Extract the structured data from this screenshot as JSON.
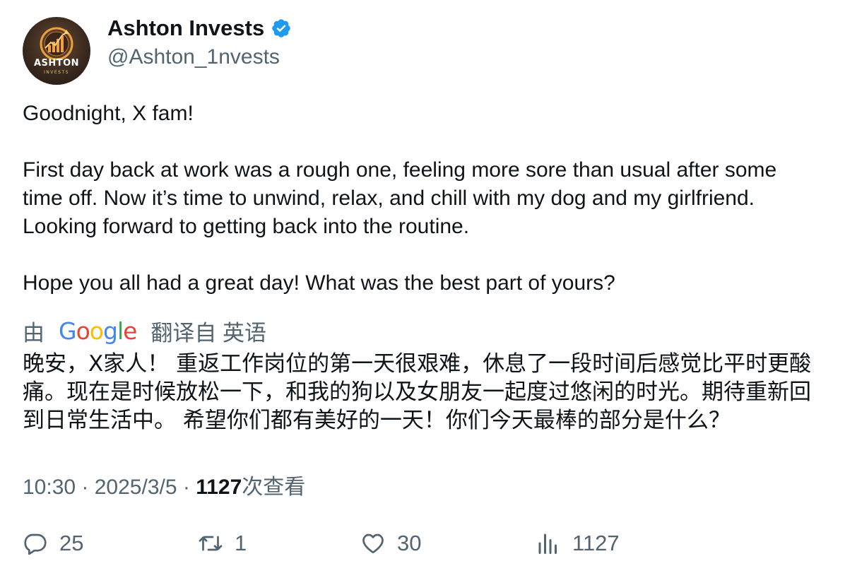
{
  "author": {
    "display_name": "Ashton Invests",
    "handle": "@Ashton_1nvests",
    "avatar_title": "ASHTON",
    "avatar_subtitle": "INVESTS",
    "verified_icon": "verified-badge-icon"
  },
  "tweet": {
    "paragraphs": [
      "Goodnight, X fam!",
      "First day back at work was a rough one, feeling more sore than usual after some time off. Now it’s time to unwind, relax, and chill with my dog and my girlfriend. Looking forward to getting back into the routine.",
      "Hope you all had a great day! What was the best part of yours?"
    ]
  },
  "translation": {
    "prefix": "由",
    "brand": "Google",
    "suffix": "翻译自 英语",
    "text": "晚安，X家人！ 重返工作岗位的第一天很艰难，休息了一段时间后感觉比平时更酸痛。现在是时候放松一下，和我的狗以及女朋友一起度过悠闲的时光。期待重新回到日常生活中。 希望你们都有美好的一天！你们今天最棒的部分是什么？"
  },
  "meta": {
    "time": "10:30",
    "separator": " · ",
    "date": "2025/3/5",
    "views_count": "1127",
    "views_label": "次查看"
  },
  "actions": {
    "reply": {
      "icon": "reply-icon",
      "count": "25"
    },
    "repost": {
      "icon": "repost-icon",
      "count": "1"
    },
    "like": {
      "icon": "like-icon",
      "count": "30"
    },
    "views": {
      "icon": "views-icon",
      "count": "1127"
    }
  },
  "colors": {
    "text_primary": "#0f1419",
    "text_secondary": "#536471",
    "verified_blue": "#1d9bf0",
    "google_blue": "#4285F4",
    "google_red": "#EA4335",
    "google_yellow": "#FBBC05",
    "google_green": "#34A853"
  }
}
